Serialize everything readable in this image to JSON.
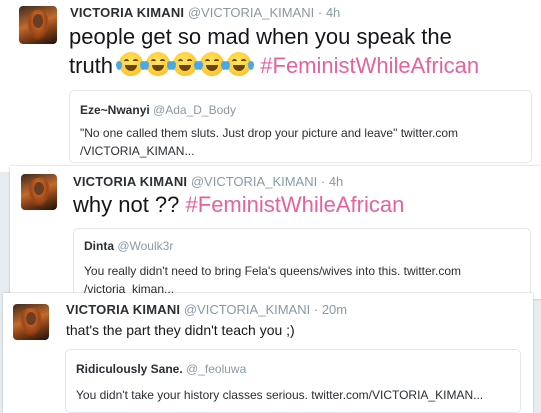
{
  "tweets": [
    {
      "author_name": "VICTORIA KIMANI",
      "author_handle": "@VICTORIA_KIMANI",
      "separator": "·",
      "time": "4h",
      "text_line1": "people get so mad when you speak the",
      "text_line2_prefix": "truth ",
      "emoji": "face-with-tears-of-joy",
      "emoji_count": 5,
      "hashtag": "#FeministWhileAfrican",
      "quote": {
        "name": "Eze~Nwanyi",
        "handle": "@Ada_D_Body",
        "text_line1": "\"No one called them sluts. Just drop your picture and leave\" twitter.com",
        "text_line2": "/VICTORIA_KIMAN..."
      }
    },
    {
      "author_name": "VICTORIA KIMANI",
      "author_handle": "@VICTORIA_KIMANI",
      "separator": "·",
      "time": "4h",
      "text": "why not ?? ",
      "hashtag": "#FeministWhileAfrican",
      "quote": {
        "name": "Dinta",
        "handle": "@Woulk3r",
        "text_line1": "You really didn't need to bring Fela's queens/wives into this.  twitter.com",
        "text_line2": "/victoria_kiman..."
      }
    },
    {
      "author_name": "VICTORIA KIMANI",
      "author_handle": "@VICTORIA_KIMANI",
      "separator": "·",
      "time": "20m",
      "text": "that's the part they didn't teach you ;)",
      "quote": {
        "name": "Ridiculously Sane.",
        "handle": "@_feoluwa",
        "text_line1": "You didn't take your history classes serious. twitter.com/VICTORIA_KIMAN..."
      }
    }
  ]
}
